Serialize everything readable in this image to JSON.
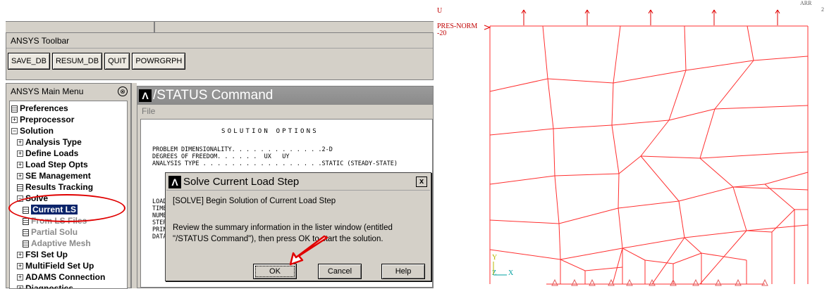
{
  "toolbar": {
    "title": "ANSYS Toolbar",
    "buttons": [
      "SAVE_DB",
      "RESUM_DB",
      "QUIT",
      "POWRGRPH"
    ]
  },
  "main_menu": {
    "title": "ANSYS Main Menu",
    "collapse_symbol": "⊗",
    "items": [
      {
        "label": "Preferences",
        "kind": "doc"
      },
      {
        "label": "Preprocessor",
        "kind": "plus"
      },
      {
        "label": "Solution",
        "kind": "minus"
      },
      {
        "label": "Analysis Type",
        "kind": "plus"
      },
      {
        "label": "Define Loads",
        "kind": "plus"
      },
      {
        "label": "Load Step Opts",
        "kind": "plus"
      },
      {
        "label": "SE Management",
        "kind": "plus"
      },
      {
        "label": "Results Tracking",
        "kind": "doc"
      },
      {
        "label": "Solve",
        "kind": "minus"
      },
      {
        "label": "Current LS",
        "kind": "doc",
        "selected": true
      },
      {
        "label": "From LS Files",
        "kind": "doc",
        "grey": true
      },
      {
        "label": "Partial Solu",
        "kind": "doc",
        "grey": true
      },
      {
        "label": "Adaptive Mesh",
        "kind": "doc",
        "grey": true
      },
      {
        "label": "FSI Set Up",
        "kind": "plus"
      },
      {
        "label": "MultiField Set Up",
        "kind": "plus"
      },
      {
        "label": "ADAMS Connection",
        "kind": "plus"
      },
      {
        "label": "Diagnostics",
        "kind": "plus"
      }
    ]
  },
  "status_window": {
    "title": "/STATUS Command",
    "menu_file": "File",
    "heading": "SOLUTION OPTIONS",
    "lines": [
      "PROBLEM DIMENSIONALITY. . . . . . . . . . . . .2-D",
      "DEGREES OF FREEDOM. . . . . .  UX   UY",
      "ANALYSIS TYPE . . . . . . . . . . . . . . . . .STATIC (STEADY-STATE)"
    ],
    "truncated_lines": [
      "LOAD",
      "TIME",
      "NUMB",
      "STEP",
      "PRIN",
      "DATA"
    ]
  },
  "solve_dialog": {
    "title": "Solve Current Load Step",
    "close": "x",
    "line1": "[SOLVE] Begin Solution of Current Load Step",
    "line2": "Review the summary information in the lister window (entitled",
    "line3": "\"/STATUS Command\"), then press OK to start the solution.",
    "ok": "OK",
    "cancel": "Cancel",
    "help": "Help",
    "annotation_color": "#e00000"
  },
  "plot": {
    "label_u": "U",
    "label_pres": "PRES-NORM",
    "label_value": "-20",
    "corner_text_1": "ARR",
    "corner_text_2": "2",
    "axis_y": "Y",
    "axis_z": "Z",
    "axis_x": "X",
    "mesh_color": "#ff3030",
    "load_color": "#e00000"
  }
}
